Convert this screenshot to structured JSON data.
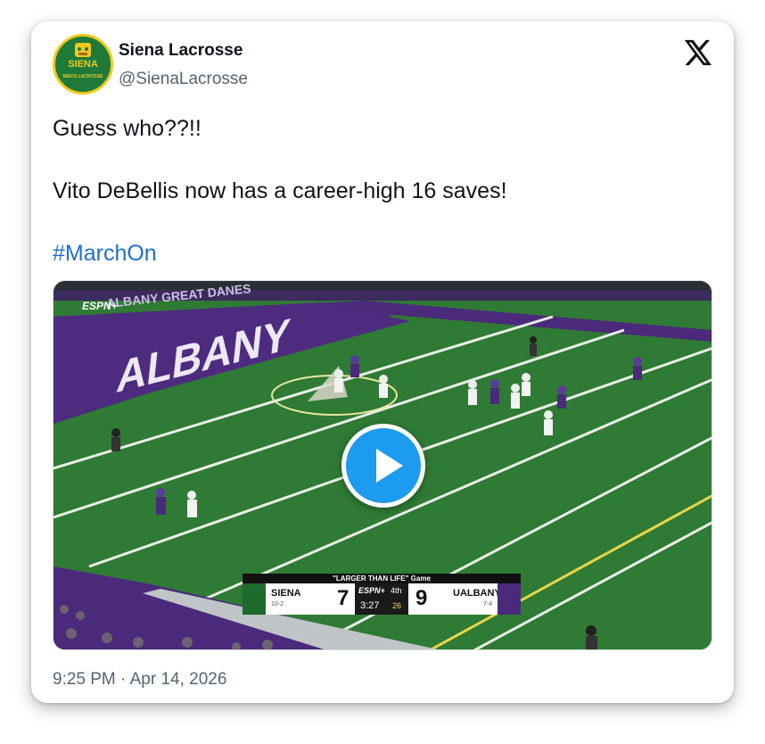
{
  "tweet": {
    "display_name": "Siena Lacrosse",
    "handle": "@SienaLacrosse",
    "avatar_text_top": "SIENA",
    "avatar_text_bottom": "MEN'S LACROSSE",
    "line1": "Guess who??!!",
    "line2": "Vito DeBellis now has a career-high 16 saves!",
    "hashtag": "#MarchOn",
    "timestamp": "9:25 PM · Apr 14, 2026"
  },
  "video": {
    "field_text": "ALBANY",
    "banner_text": "ALBANY GREAT DANES",
    "network": "ESPN+",
    "scorebug": {
      "header": "\"LARGER THAN LIFE\" Game",
      "home_team": "SIENA",
      "home_record": "10-2",
      "home_score": "7",
      "away_team": "UALBANY",
      "away_record": "7-4",
      "away_score": "9",
      "network": "ESPN+",
      "period": "4th",
      "clock": "3:27",
      "shot_clock": "26"
    }
  },
  "colors": {
    "accent": "#1d9bf0",
    "hashtag": "#1d6fd1",
    "field_green": "#2f7a34",
    "albany_purple": "#4b2a7b",
    "siena_green": "#1f6b2d",
    "siena_gold": "#f3c81a"
  },
  "icons": [
    "x-logo-icon",
    "play-icon"
  ]
}
